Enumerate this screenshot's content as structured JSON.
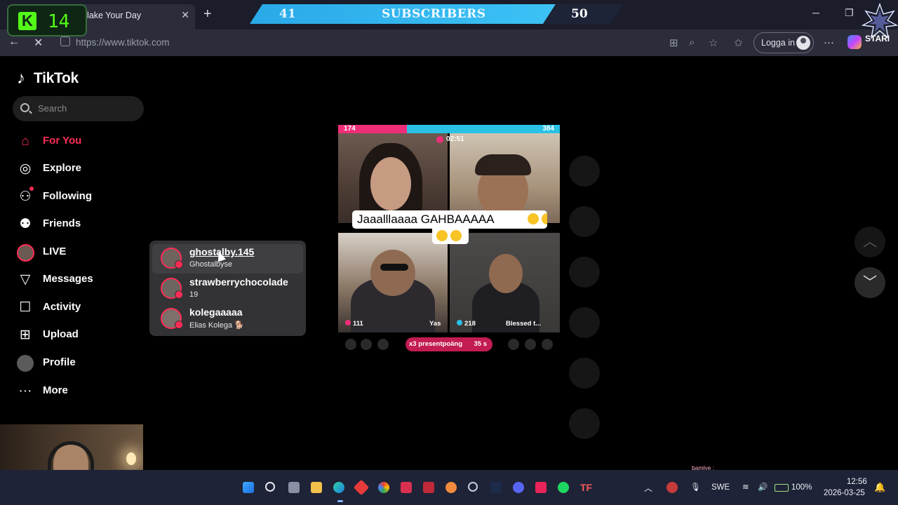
{
  "browser": {
    "tab_title": "lake Your Day",
    "tab_close": "✕",
    "new_tab": "+",
    "url": "https://www.tiktok.com",
    "login_label": "Logga in",
    "more_icon": "···",
    "win_min": "─",
    "win_restore": "❐"
  },
  "overlay": {
    "kick_count": "14",
    "kick_letter": "K",
    "sub_left": "41",
    "sub_label": "SUBSCRIBERS",
    "sub_right": "50",
    "star_text": "STARI",
    "colors": {
      "kick": "#53fc18",
      "subs": "#3cc2f5"
    }
  },
  "tiktok": {
    "logo": "TikTok",
    "search_placeholder": "Search",
    "nav": [
      {
        "label": "For You",
        "icon": "home-icon",
        "active": true
      },
      {
        "label": "Explore",
        "icon": "compass-icon"
      },
      {
        "label": "Following",
        "icon": "following-icon",
        "badge": true
      },
      {
        "label": "Friends",
        "icon": "friends-icon"
      },
      {
        "label": "LIVE",
        "icon": "live-avatar-icon"
      },
      {
        "label": "Messages",
        "icon": "send-icon"
      },
      {
        "label": "Activity",
        "icon": "activity-icon"
      },
      {
        "label": "Upload",
        "icon": "plus-square-icon"
      },
      {
        "label": "Profile",
        "icon": "profile-avatar-icon"
      },
      {
        "label": "More",
        "icon": "more-dots-icon"
      }
    ],
    "live_popup": [
      {
        "name": "ghostalby.145",
        "sub": "Ghostalbyse"
      },
      {
        "name": "strawberrychocolade",
        "sub": "19"
      },
      {
        "name": "kolegaaaaa",
        "sub": "Elias Kolega 🐕"
      }
    ],
    "live": {
      "battle_left": "174",
      "battle_right": "384",
      "timer": "02:51",
      "caption_line1": "Jaaalllaaaa GAHBAAAAA",
      "cells": [
        {
          "score": "111",
          "name": "Yas"
        },
        {
          "score": "218",
          "name": "Blessed t..."
        }
      ],
      "gift_text": "x3 presentpoäng",
      "gift_time": "35 s"
    }
  },
  "taskbar": {
    "lang": "SWE",
    "battery": "100%",
    "time": "12:56",
    "date": "2026-03-25",
    "chat_snippet": "bamlye :"
  }
}
